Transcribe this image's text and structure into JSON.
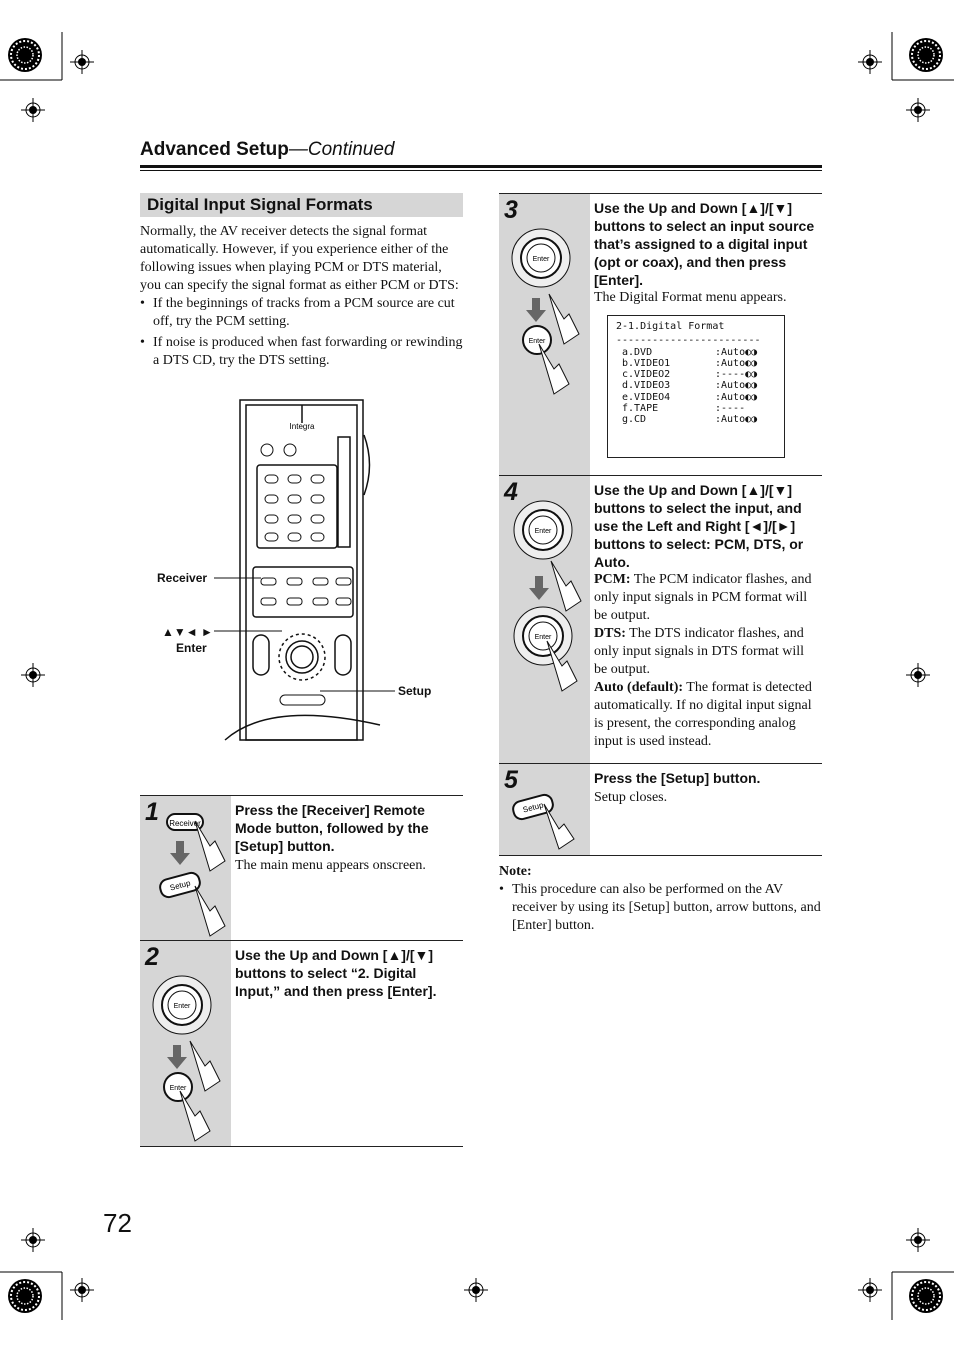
{
  "header": {
    "title": "Advanced Setup",
    "continued": "—Continued"
  },
  "section": {
    "title": "Digital Input Signal Formats",
    "intro": "Normally, the AV receiver detects the signal format automatically. However, if you experience either of the following issues when playing PCM or DTS material, you can specify the signal format as either PCM or DTS:",
    "bullets": [
      "If the beginnings of tracks from a PCM source are cut off, try the PCM setting.",
      "If noise is produced when fast forwarding or rewinding a DTS CD, try the DTS setting."
    ]
  },
  "remote": {
    "brand": "Integra",
    "callouts": {
      "receiver": "Receiver",
      "arrows": "▲▼◄ ►",
      "enter": "Enter",
      "setup": "Setup"
    }
  },
  "steps": [
    {
      "num": "1",
      "instruction": "Press the [Receiver] Remote Mode button, followed by the [Setup] button.",
      "detail": "The main menu appears onscreen."
    },
    {
      "num": "2",
      "instruction": "Use the Up and Down [▲]/[▼] buttons to select “2. Digital Input,” and then press [Enter].",
      "detail": ""
    },
    {
      "num": "3",
      "instruction": "Use the Up and Down [▲]/[▼] buttons to select an input source that’s assigned to a digital input (opt or coax), and then press [Enter].",
      "detail": "The Digital Format menu appears."
    },
    {
      "num": "4",
      "instruction": "Use the Up and Down [▲]/[▼] buttons to select the input, and use the Left and Right [◄]/[►] buttons to select: PCM, DTS, or Auto.",
      "options": [
        {
          "term": "PCM:",
          "desc": " The PCM indicator flashes, and only input signals in PCM format will be output."
        },
        {
          "term": "DTS:",
          "desc": " The DTS indicator flashes, and only input signals in DTS format will be output."
        },
        {
          "term": "Auto (default):",
          "desc": " The format is detected automatically. If no digital input signal is present, the corresponding analog input is used instead."
        }
      ]
    },
    {
      "num": "5",
      "instruction": "Press the [Setup] button.",
      "detail": "Setup closes."
    }
  ],
  "screen": {
    "title": "2-1.Digital Format",
    "divider": "------------------------",
    "rows": [
      {
        "input": "a.DVD",
        "value": ":Auto◐◑"
      },
      {
        "input": "b.VIDEO1",
        "value": ":Auto◐◑"
      },
      {
        "input": "c.VIDEO2",
        "value": ":----◐◑"
      },
      {
        "input": "d.VIDEO3",
        "value": ":Auto◐◑"
      },
      {
        "input": "e.VIDEO4",
        "value": ":Auto◐◑"
      },
      {
        "input": "f.TAPE",
        "value": ":----"
      },
      {
        "input": "g.CD",
        "value": ":Auto◐◑"
      }
    ]
  },
  "button_labels": {
    "receiver": "Receiver",
    "setup": "Setup",
    "enter": "Enter"
  },
  "note": {
    "title": "Note:",
    "text": "This procedure can also be performed on the AV receiver by using its [Setup] button, arrow buttons, and [Enter] button."
  },
  "page_number": "72"
}
